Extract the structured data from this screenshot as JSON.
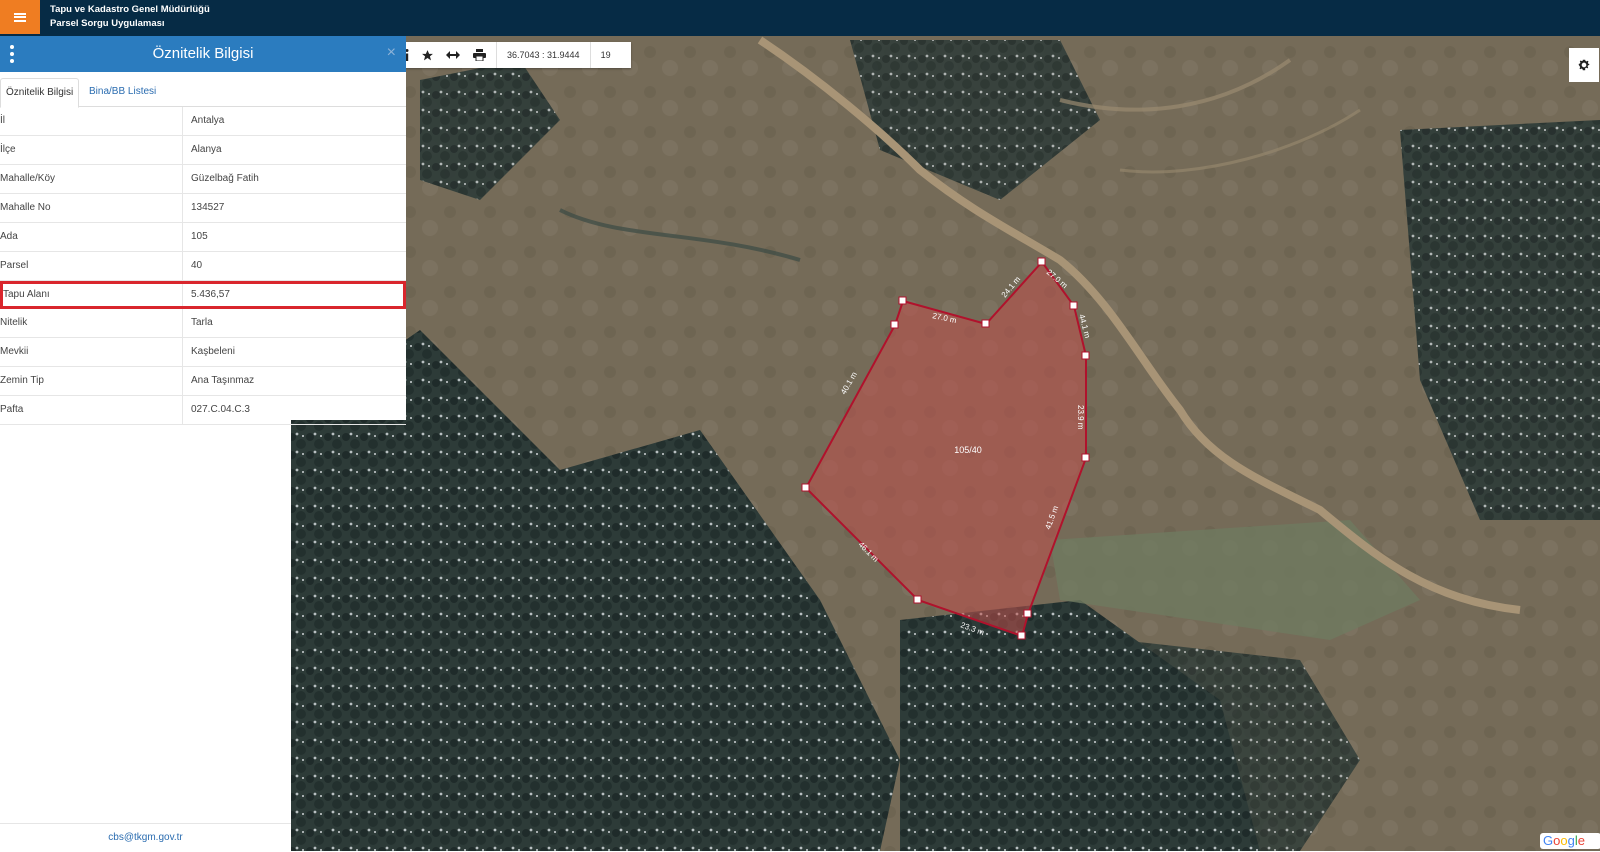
{
  "app": {
    "title_line1": "Tapu ve Kadastro Genel Müdürlüğü",
    "title_line2": "Parsel Sorgu Uygulaması"
  },
  "toolbar": {
    "coordinates": "36.7043 : 31.9444",
    "zoom_level": "19"
  },
  "panel": {
    "title": "Öznitelik Bilgisi",
    "close_glyph": "×",
    "tabs": [
      "Öznitelik Bilgisi",
      "Bina/BB Listesi"
    ],
    "rows": [
      {
        "key": "İl",
        "value": "Antalya"
      },
      {
        "key": "İlçe",
        "value": "Alanya"
      },
      {
        "key": "Mahalle/Köy",
        "value": "Güzelbağ Fatih"
      },
      {
        "key": "Mahalle No",
        "value": "134527"
      },
      {
        "key": "Ada",
        "value": "105"
      },
      {
        "key": "Parsel",
        "value": "40"
      },
      {
        "key": "Tapu Alanı",
        "value": "5.436,57"
      },
      {
        "key": "Nitelik",
        "value": "Tarla"
      },
      {
        "key": "Mevkii",
        "value": "Kaşbeleni"
      },
      {
        "key": "Zemin Tip",
        "value": "Ana Taşınmaz"
      },
      {
        "key": "Pafta",
        "value": "027.C.04.C.3"
      }
    ],
    "highlight_color": "#d9262d",
    "footer_email": "cbs@tkgm.gov.tr"
  },
  "map": {
    "parcel_label": "105/40",
    "edge_labels": [
      "27.0 m",
      "24.1 m",
      "27.0 m",
      "44.1 m",
      "23.9 m",
      "41.5 m",
      "23.3 m",
      "46.1 m",
      "40.1 m"
    ],
    "parcel_fill_color": "#c0504d",
    "parcel_stroke_color": "#b0122c",
    "attribution_word": "Google"
  },
  "icons": {
    "menu": "hamburger-icon",
    "panel_menu": "kebab-icon",
    "info": "info-icon",
    "bookmark": "star-icon",
    "measure": "measure-icon",
    "print": "printer-icon",
    "settings": "gear-icon"
  },
  "colors": {
    "topbar": "#062b45",
    "menu_button": "#ef7d22",
    "panel_header": "#2b7cbf"
  }
}
